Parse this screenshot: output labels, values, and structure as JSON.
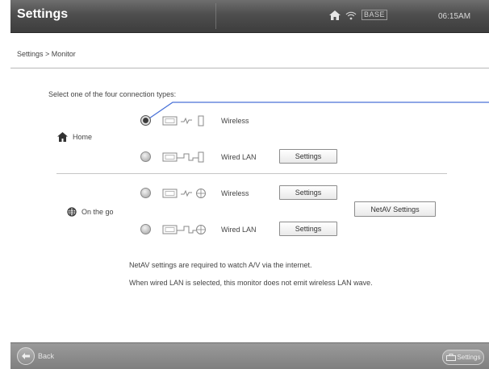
{
  "header": {
    "title": "Settings",
    "status": {
      "base_label": "BASE",
      "time": "06:15AM"
    }
  },
  "breadcrumb": "Settings > Monitor",
  "instruction": "Select one of the four connection types:",
  "groups": {
    "home": {
      "label": "Home",
      "icon": "home-icon",
      "rows": [
        {
          "label": "Wireless",
          "selected": true
        },
        {
          "label": "Wired LAN",
          "selected": false,
          "button": "Settings"
        }
      ]
    },
    "on_the_go": {
      "label": "On the go",
      "icon": "globe-icon",
      "rows": [
        {
          "label": "Wireless",
          "selected": false,
          "button": "Settings"
        },
        {
          "label": "Wired LAN",
          "selected": false,
          "button": "Settings"
        }
      ],
      "netav_button": "NetAV Settings"
    }
  },
  "notes": [
    "NetAV settings are required to watch A/V via the internet.",
    "When wired LAN is selected, this monitor does not emit wireless LAN wave."
  ],
  "footer": {
    "back_label": "Back",
    "settings_label": "Settings"
  },
  "colors": {
    "callout_line": "#4a72d8",
    "header_bg": "#4e4e4e",
    "footer_bg": "#8a8a8a"
  }
}
